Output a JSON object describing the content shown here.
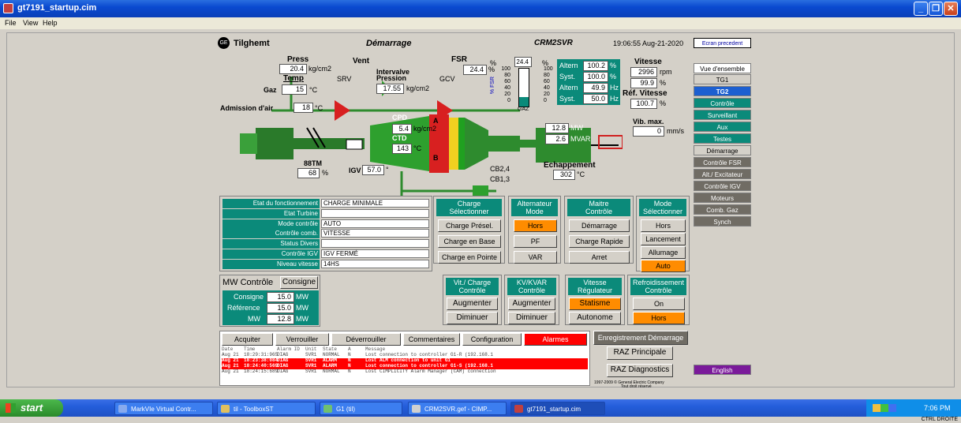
{
  "window": {
    "title": "gt7191_startup.cim"
  },
  "menu": [
    "File",
    "View",
    "Help"
  ],
  "header": {
    "site": "Tilghemt",
    "mode": "Démarrage",
    "unit": "CRM2SVR",
    "time": "19:06:55 Aug-21-2020",
    "back_button": "Ecran precedent",
    "ge_logo": "GE"
  },
  "process": {
    "press_label": "Press",
    "press_value": "20.4",
    "press_unit": "kg/cm2",
    "temp_label": "Temp",
    "gaz_label": "Gaz",
    "gaz_temp": "15",
    "gaz_temp_unit": "°C",
    "vent_label": "Vent",
    "srv_label": "SRV",
    "gcv_label": "GCV",
    "interval_label1": "Intervalve",
    "interval_label2": "Pression",
    "interval_value": "17.55",
    "interval_unit": "kg/cm2",
    "fsr_label": "FSR",
    "fsr_value": "24.4",
    "fsr_unit": "%",
    "air_label": "Admission d'air",
    "air_value": "18",
    "air_unit": "°C",
    "cpd_label": "CPD",
    "cpd_value": "5.4",
    "cpd_unit": "kg/cm2",
    "ctd_label": "CTD",
    "ctd_value": "143",
    "ctd_unit": "°C",
    "igv_label": "IGV",
    "igv_value": "57.0",
    "igv_unit": "°",
    "tm_label": "88TM",
    "tm_value": "68",
    "tm_unit": "%",
    "marker_a": "A",
    "marker_b": "B",
    "mw_value": "12.8",
    "mw_unit": "MW",
    "mvar_value": "2.6",
    "mvar_unit": "MVAR",
    "cb_top": "CB2,4",
    "cb_bot": "CB1,3",
    "exhaust_label": "Echappement",
    "exhaust_value": "302",
    "exhaust_unit": "°C",
    "bar_pct_left": "%",
    "bar_pct_right": "%",
    "bar_top_value": "24.4",
    "bar_mid_label": "% FSR",
    "bar_bottom_label": "GAZ",
    "bar_ticks": [
      "100",
      "80",
      "60",
      "40",
      "20",
      "0"
    ],
    "bar_fill_fraction": 0.244,
    "alt1_label": "Altern",
    "alt1_value": "100.2",
    "alt1_unit": "%",
    "syst1_label": "Syst.",
    "syst1_value": "100.0",
    "syst1_unit": "%",
    "alt2_label": "Altern",
    "alt2_value": "49.9",
    "alt2_unit": "Hz",
    "syst2_label": "Syst.",
    "syst2_value": "50.0",
    "syst2_unit": "Hz",
    "speed_label": "Vitesse",
    "speed_value": "2996",
    "speed_unit": "rpm",
    "speed_pct": "99.9",
    "speed_pct_unit": "%",
    "ref_label": "Réf. Vitesse",
    "ref_value": "100.7",
    "ref_unit": "%",
    "vib_label": "Vib. max.",
    "vib_value": "0",
    "vib_unit": "mm/s"
  },
  "status": [
    {
      "label": "Etat du fonctionnement",
      "value": "CHARGE MINIMALE"
    },
    {
      "label": "Etat Turbine",
      "value": ""
    },
    {
      "label": "Mode contrôle",
      "value": "AUTO"
    },
    {
      "label": "Contrôle comb.",
      "value": "VITESSE"
    },
    {
      "label": "Status Divers",
      "value": ""
    },
    {
      "label": "Contrôle IGV",
      "value": "IGV FERMÉ"
    },
    {
      "label": "Niveau vitesse",
      "value": "14HS"
    }
  ],
  "load_panel": {
    "title1": "Charge",
    "title2": "Sélectionner",
    "buttons": [
      "Charge Présel.",
      "Charge en Base",
      "Charge en Pointe"
    ]
  },
  "alt_panel": {
    "title1": "Alternateur",
    "title2": "Mode",
    "buttons": [
      "Hors",
      "PF",
      "VAR"
    ]
  },
  "master_panel": {
    "title1": "Maitre",
    "title2": "Contrôle",
    "buttons": [
      "Démarrage",
      "Charge Rapide",
      "Arret"
    ]
  },
  "mode_panel": {
    "title1": "Mode",
    "title2": "Sélectionner",
    "buttons": [
      "Hors",
      "Lancement",
      "Allumage",
      "Auto"
    ]
  },
  "mw_panel": {
    "title": "MW Contrôle",
    "consigne_button": "Consigne",
    "rows": [
      {
        "label": "Consigne",
        "value": "15.0",
        "unit": "MW"
      },
      {
        "label": "Référence",
        "value": "15.0",
        "unit": "MW"
      },
      {
        "label": "MW",
        "value": "12.8",
        "unit": "MW"
      }
    ]
  },
  "vit_panel": {
    "title1": "Vit./ Charge",
    "title2": "Contrôle",
    "buttons": [
      "Augmenter",
      "Diminuer"
    ]
  },
  "kv_panel": {
    "title1": "KV/KVAR",
    "title2": "Contrôle",
    "buttons": [
      "Augmenter",
      "Diminuer"
    ]
  },
  "reg_panel": {
    "title1": "Vitesse",
    "title2": "Régulateur",
    "buttons": [
      "Statisme",
      "Autonome"
    ]
  },
  "cool_panel": {
    "title1": "Refroidissement",
    "title2": "Contrôle",
    "buttons": [
      "On",
      "Hors"
    ]
  },
  "alarm_toolbar": [
    "Acquiter",
    "Verrouiller",
    "Déverrouiller",
    "Commentaires",
    "Configuration",
    "Alarmes"
  ],
  "alarm_headers": [
    "Date",
    "Time",
    "Alarm ID",
    "Unit",
    "State",
    "A",
    "Message"
  ],
  "alarms": [
    {
      "date": "Aug 21",
      "time": "18:29:31:965",
      "id": "DIAG",
      "unit": "SVR1",
      "state": "NORMAL",
      "a": "N",
      "msg": "Lost connection to controller G1-R (192.168.1",
      "hl": false
    },
    {
      "date": "Aug 21",
      "time": "18:23:38:084",
      "id": "DIAG",
      "unit": "SVR1",
      "state": "ALARM",
      "a": "N",
      "msg": "Lost ALM connection to unit G1",
      "hl": true
    },
    {
      "date": "Aug 21",
      "time": "18:24:40:569",
      "id": "DIAG",
      "unit": "SVR1",
      "state": "ALARM",
      "a": "N",
      "msg": "Lost connection to controller G1-S (192.168.1",
      "hl": true
    },
    {
      "date": "Aug 21",
      "time": "18:24:15:689",
      "id": "DIAG",
      "unit": "SVR1",
      "state": "NORMAL",
      "a": "N",
      "msg": "Lost CIMPLICITY Alarm Manager (CAM) connection",
      "hl": false
    }
  ],
  "actions": {
    "record": "Enregistrement Démarrage",
    "raz_main": "RAZ Principale",
    "raz_diag": "RAZ Diagnostics",
    "copyright1": "1997-2009 © General Electric Company",
    "copyright2": "Tout droit réservé"
  },
  "sidebar": [
    "Vue d'ensemble",
    "TG1",
    "TG2",
    "Contrôle",
    "Surveillant",
    "Aux",
    "Testes",
    "Démarrage",
    "Contrôle FSR",
    "Alt./ Excitateur",
    "Contrôle IGV",
    "Moteurs",
    "Comb. Gaz",
    "Synch"
  ],
  "language_button": "English",
  "taskbar": {
    "start": "start",
    "items": [
      "MarkVIe Virtual Contr...",
      "til - ToolboxST",
      "G1 (til)",
      "CRM2SVR.gef - CIMP...",
      "gt7191_startup.cim"
    ],
    "clock": "7:06 PM",
    "tray_label": "CTRL DROITE"
  },
  "colors": {
    "teal": "#0b8a7a",
    "orange": "#ff8c00",
    "alarm_red": "#ff0000",
    "english": "#7a1a9a"
  }
}
